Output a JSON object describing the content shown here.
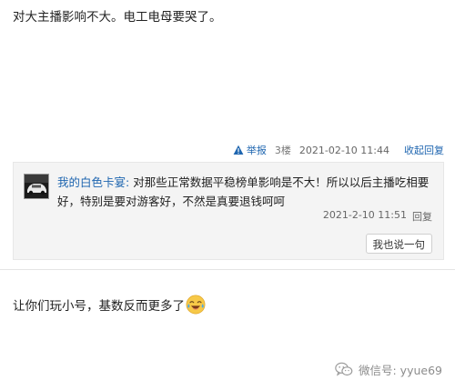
{
  "posts": [
    {
      "text": "对大主播影响不大。电工电母要哭了。"
    },
    {
      "text": "让你们玩小号，基数反而更多了"
    }
  ],
  "post_meta": {
    "report_label": "举报",
    "floor": "3楼",
    "date": "2021-02-10 11:44",
    "collapse_label": "收起回复"
  },
  "reply": {
    "username": "我的白色卡宴:",
    "text": "对那些正常数据平稳榜单影响是不大！所以以后主播吃相要好，特别是要对游客好，不然是真要退钱呵呵",
    "date": "2021-2-10 11:51",
    "reply_label": "回复"
  },
  "say_button": "我也说一句",
  "watermark": "微信号: yyue69",
  "icons": {
    "report": "warning-icon",
    "emoji": "laugh-cry-emoji-icon",
    "watermark": "wechat-icon"
  },
  "colors": {
    "link": "#1f66b0",
    "reply_bg": "#f4f4f4",
    "text": "#222222",
    "meta": "#666666"
  }
}
